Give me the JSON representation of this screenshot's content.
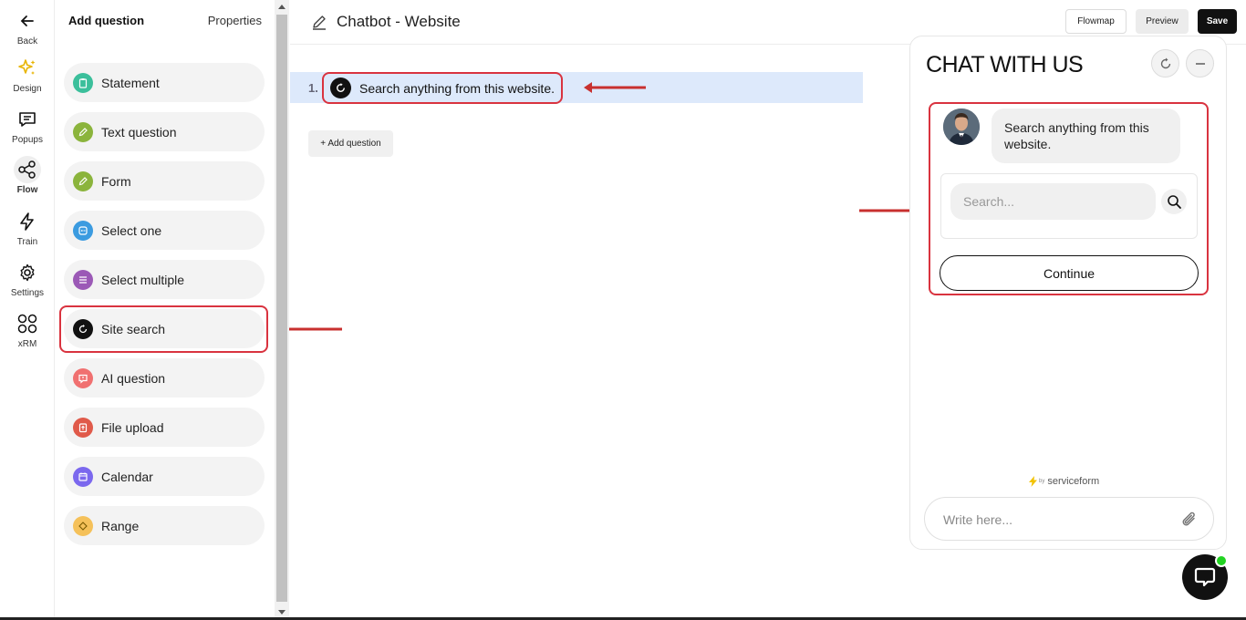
{
  "rail": {
    "back": "Back",
    "items": [
      {
        "label": "Design",
        "icon": "sparkle-icon"
      },
      {
        "label": "Popups",
        "icon": "message-square-icon"
      },
      {
        "label": "Flow",
        "icon": "share-nodes-icon"
      },
      {
        "label": "Train",
        "icon": "lightning-icon"
      },
      {
        "label": "Settings",
        "icon": "gear-icon"
      },
      {
        "label": "xRM",
        "icon": "grid-circles-icon"
      }
    ]
  },
  "panel": {
    "tab_add": "Add question",
    "tab_properties": "Properties",
    "items": [
      {
        "label": "Statement",
        "color": "#3bbf9b"
      },
      {
        "label": "Text question",
        "color": "#8bb43c"
      },
      {
        "label": "Form",
        "color": "#8bb43c"
      },
      {
        "label": "Select one",
        "color": "#3b9be0"
      },
      {
        "label": "Select multiple",
        "color": "#9b59b6"
      },
      {
        "label": "Site search",
        "color": "#111111"
      },
      {
        "label": "AI question",
        "color": "#f07070"
      },
      {
        "label": "File upload",
        "color": "#e05a4a"
      },
      {
        "label": "Calendar",
        "color": "#7b68ee"
      },
      {
        "label": "Range",
        "color": "#f5c15a"
      }
    ]
  },
  "header": {
    "title": "Chatbot - Website",
    "flowmap": "Flowmap",
    "preview": "Preview",
    "save": "Save"
  },
  "flow": {
    "number": "1.",
    "question": "Search anything from this website.",
    "add_question": "+ Add question"
  },
  "chat": {
    "title": "CHAT WITH US",
    "message": "Search anything from this website.",
    "search_placeholder": "Search...",
    "continue": "Continue",
    "powered_by": "by",
    "brand": "serviceform",
    "compose_placeholder": "Write here..."
  },
  "colors": {
    "highlight": "#d9333f",
    "flow_row": "#dde9fb",
    "launcher_dot": "#22d322"
  }
}
